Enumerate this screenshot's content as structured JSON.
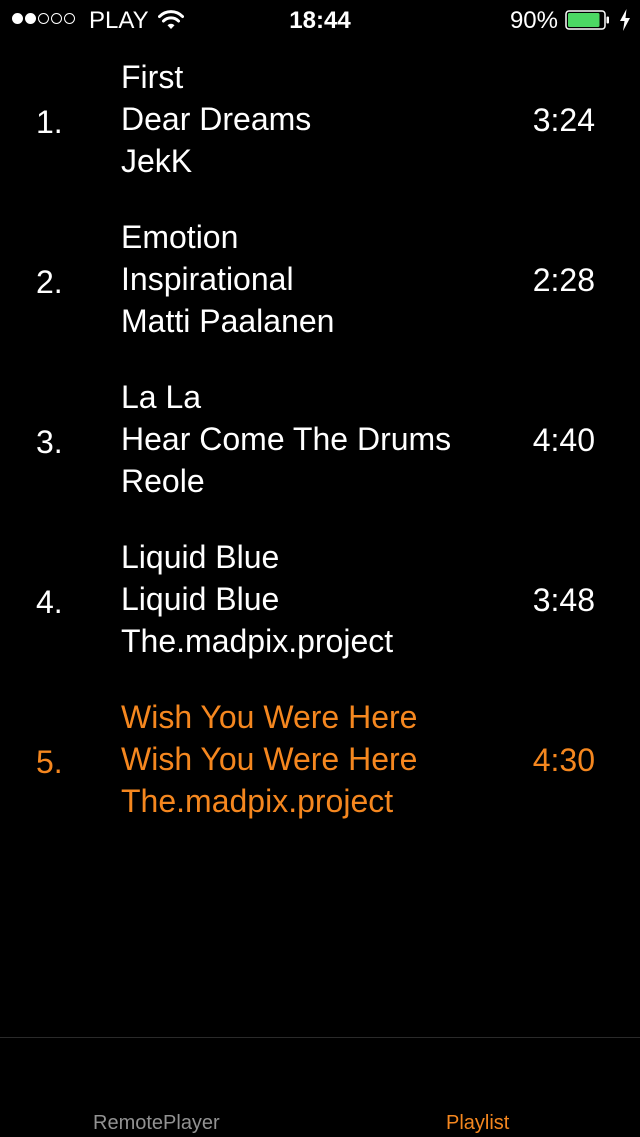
{
  "status_bar": {
    "carrier": "PLAY",
    "time": "18:44",
    "battery_percent": "90%",
    "signal_bars_filled": 2,
    "signal_bars_total": 5,
    "battery_level": 0.9,
    "icons": [
      "wifi-icon",
      "battery-icon",
      "charging-bolt-icon"
    ]
  },
  "playlist": {
    "tracks": [
      {
        "number": "1.",
        "title": "First",
        "album": "Dear Dreams",
        "artist": "JekK",
        "duration": "3:24",
        "current": false
      },
      {
        "number": "2.",
        "title": "Emotion",
        "album": "Inspirational",
        "artist": "Matti Paalanen",
        "duration": "2:28",
        "current": false
      },
      {
        "number": "3.",
        "title": "La La",
        "album": "Hear Come The Drums",
        "artist": "Reole",
        "duration": "4:40",
        "current": false
      },
      {
        "number": "4.",
        "title": "Liquid Blue",
        "album": "Liquid Blue",
        "artist": "The.madpix.project",
        "duration": "3:48",
        "current": false
      },
      {
        "number": "5.",
        "title": "Wish You Were Here",
        "album": "Wish You Were Here",
        "artist": "The.madpix.project",
        "duration": "4:30",
        "current": true
      }
    ]
  },
  "tab_bar": {
    "tabs": [
      {
        "label": "RemotePlayer",
        "active": false
      },
      {
        "label": "Playlist",
        "active": true
      }
    ]
  },
  "colors": {
    "background": "#000000",
    "text": "#ffffff",
    "accent": "#F5871F",
    "inactive_tab": "#929292",
    "battery_fill": "#4CD964"
  }
}
